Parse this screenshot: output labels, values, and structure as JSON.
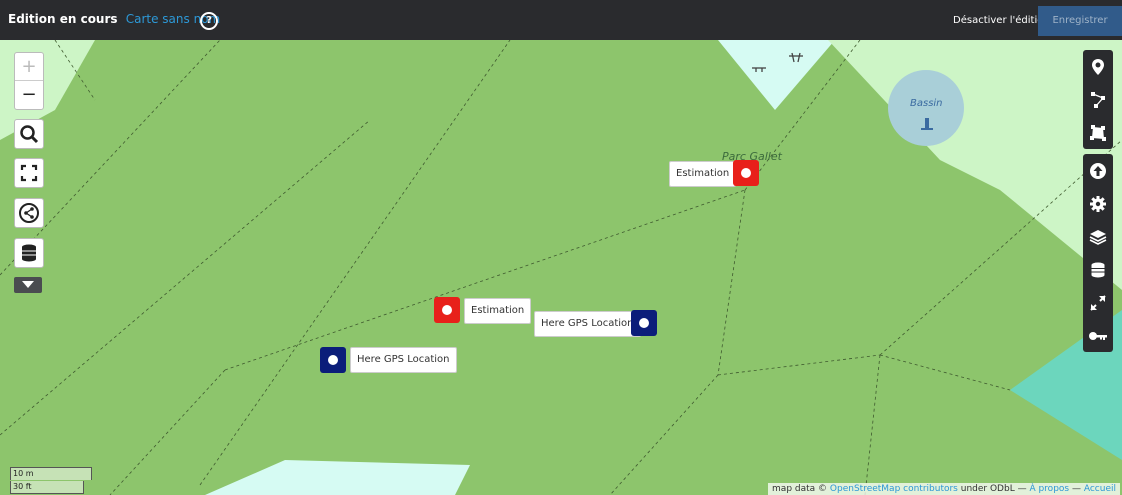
{
  "header": {
    "title": "Edition en cours",
    "map_name": "Carte sans nom",
    "help_icon": "?",
    "disable_edit_label": "Désactiver l'édition",
    "save_label": "Enregistrer"
  },
  "left_controls": {
    "zoom_in": "+",
    "zoom_out": "−",
    "search_icon": "search-icon",
    "fullscreen_icon": "fullscreen-icon",
    "share_icon": "share-icon",
    "data_layers_icon": "layers-icon",
    "more_icon": "caret-down-icon"
  },
  "right_toolbar": {
    "group1": [
      "marker-icon",
      "polyline-icon",
      "polygon-icon"
    ],
    "group2": [
      "upload-icon",
      "gear-icon",
      "layers-icon",
      "database-icon",
      "move-icon",
      "key-icon"
    ]
  },
  "map": {
    "place_label": "Parc Gallet",
    "basin_label": "Bassin",
    "markers": [
      {
        "id": "estimation-1",
        "label": "Estimation",
        "color": "#e8201a"
      },
      {
        "id": "estimation-2",
        "label": "Estimation",
        "color": "#e8201a"
      },
      {
        "id": "gps-1",
        "label": "Here GPS Location",
        "color": "#0b1d7a"
      },
      {
        "id": "gps-2",
        "label": "Here GPS Location",
        "color": "#0b1d7a"
      }
    ]
  },
  "scale": {
    "metric": "10 m",
    "imperial": "30 ft"
  },
  "attribution": {
    "prefix": "map data ©",
    "osm": "OpenStreetMap contributors",
    "under": "under ODbL —",
    "about": "À propos",
    "sep": "—",
    "home": "Accueil"
  },
  "colors": {
    "park": "#8dc56c",
    "grass_light": "#cdf5c6",
    "water": "#aad3df",
    "accent": "#2d98d6"
  }
}
